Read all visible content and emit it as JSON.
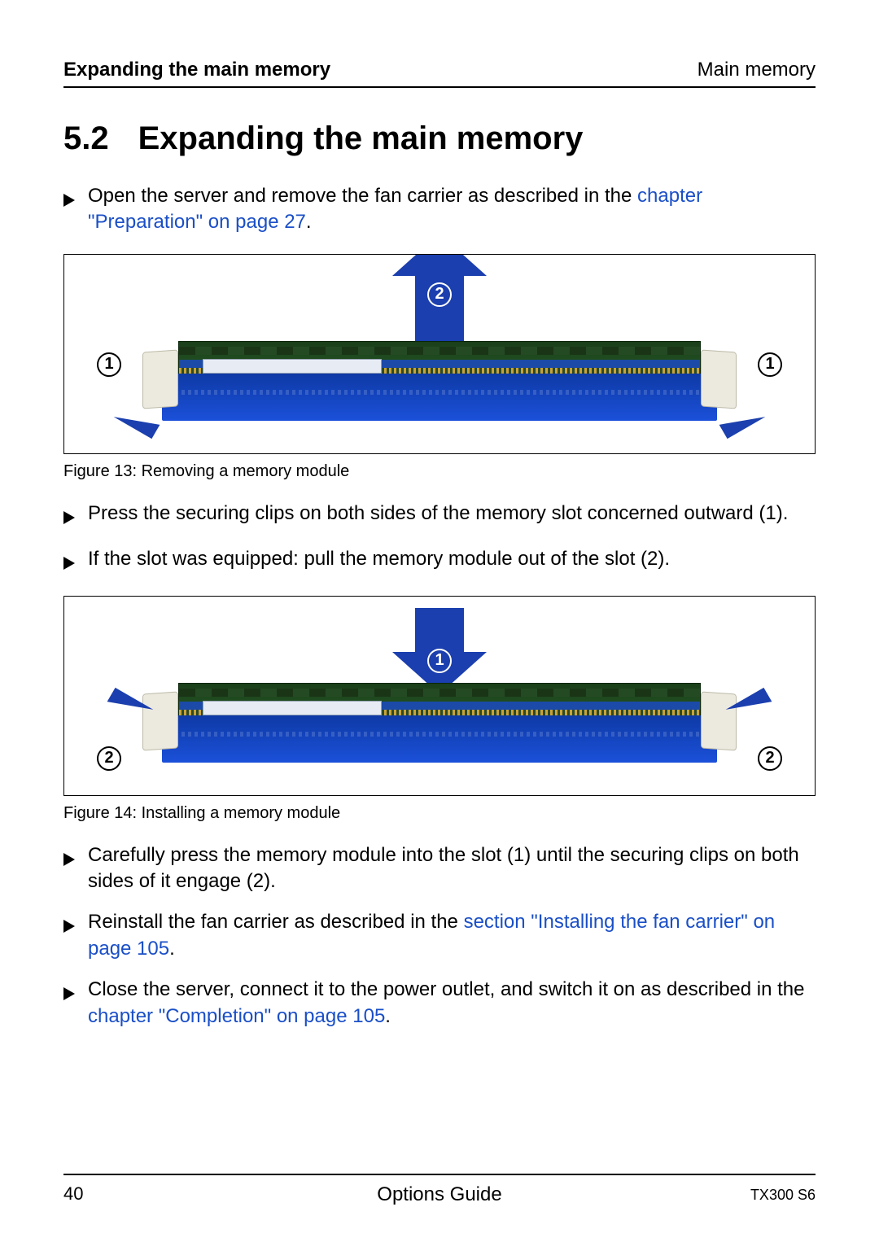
{
  "header": {
    "left": "Expanding the main memory",
    "right": "Main memory"
  },
  "section": {
    "number": "5.2",
    "title": "Expanding the main memory"
  },
  "steps_top": [
    {
      "pre": "Open the server and remove the fan carrier as described in the ",
      "link": "chapter \"Preparation\" on page 27",
      "post": "."
    }
  ],
  "figure13": {
    "caption": "Figure 13: Removing a memory module",
    "callout_center": "2",
    "callout_left": "1",
    "callout_right": "1"
  },
  "steps_mid": [
    {
      "pre": "Press the securing clips on both sides of the memory slot concerned outward (1).",
      "link": "",
      "post": ""
    },
    {
      "pre": "If the slot was equipped: pull the memory module out of the slot (2).",
      "link": "",
      "post": ""
    }
  ],
  "figure14": {
    "caption": "Figure 14: Installing a memory module",
    "callout_center": "1",
    "callout_left": "2",
    "callout_right": "2"
  },
  "steps_bottom": [
    {
      "pre": "Carefully press the memory module into the slot (1) until the securing clips on both sides of it engage (2).",
      "link": "",
      "post": ""
    },
    {
      "pre": "Reinstall the fan carrier as described in the ",
      "link": "section \"Installing the fan carrier\" on page 105",
      "post": "."
    },
    {
      "pre": "Close the server, connect it to the power outlet, and switch it on as described in the ",
      "link": "chapter \"Completion\" on page 105",
      "post": "."
    }
  ],
  "footer": {
    "page": "40",
    "center": "Options Guide",
    "right": "TX300 S6"
  }
}
